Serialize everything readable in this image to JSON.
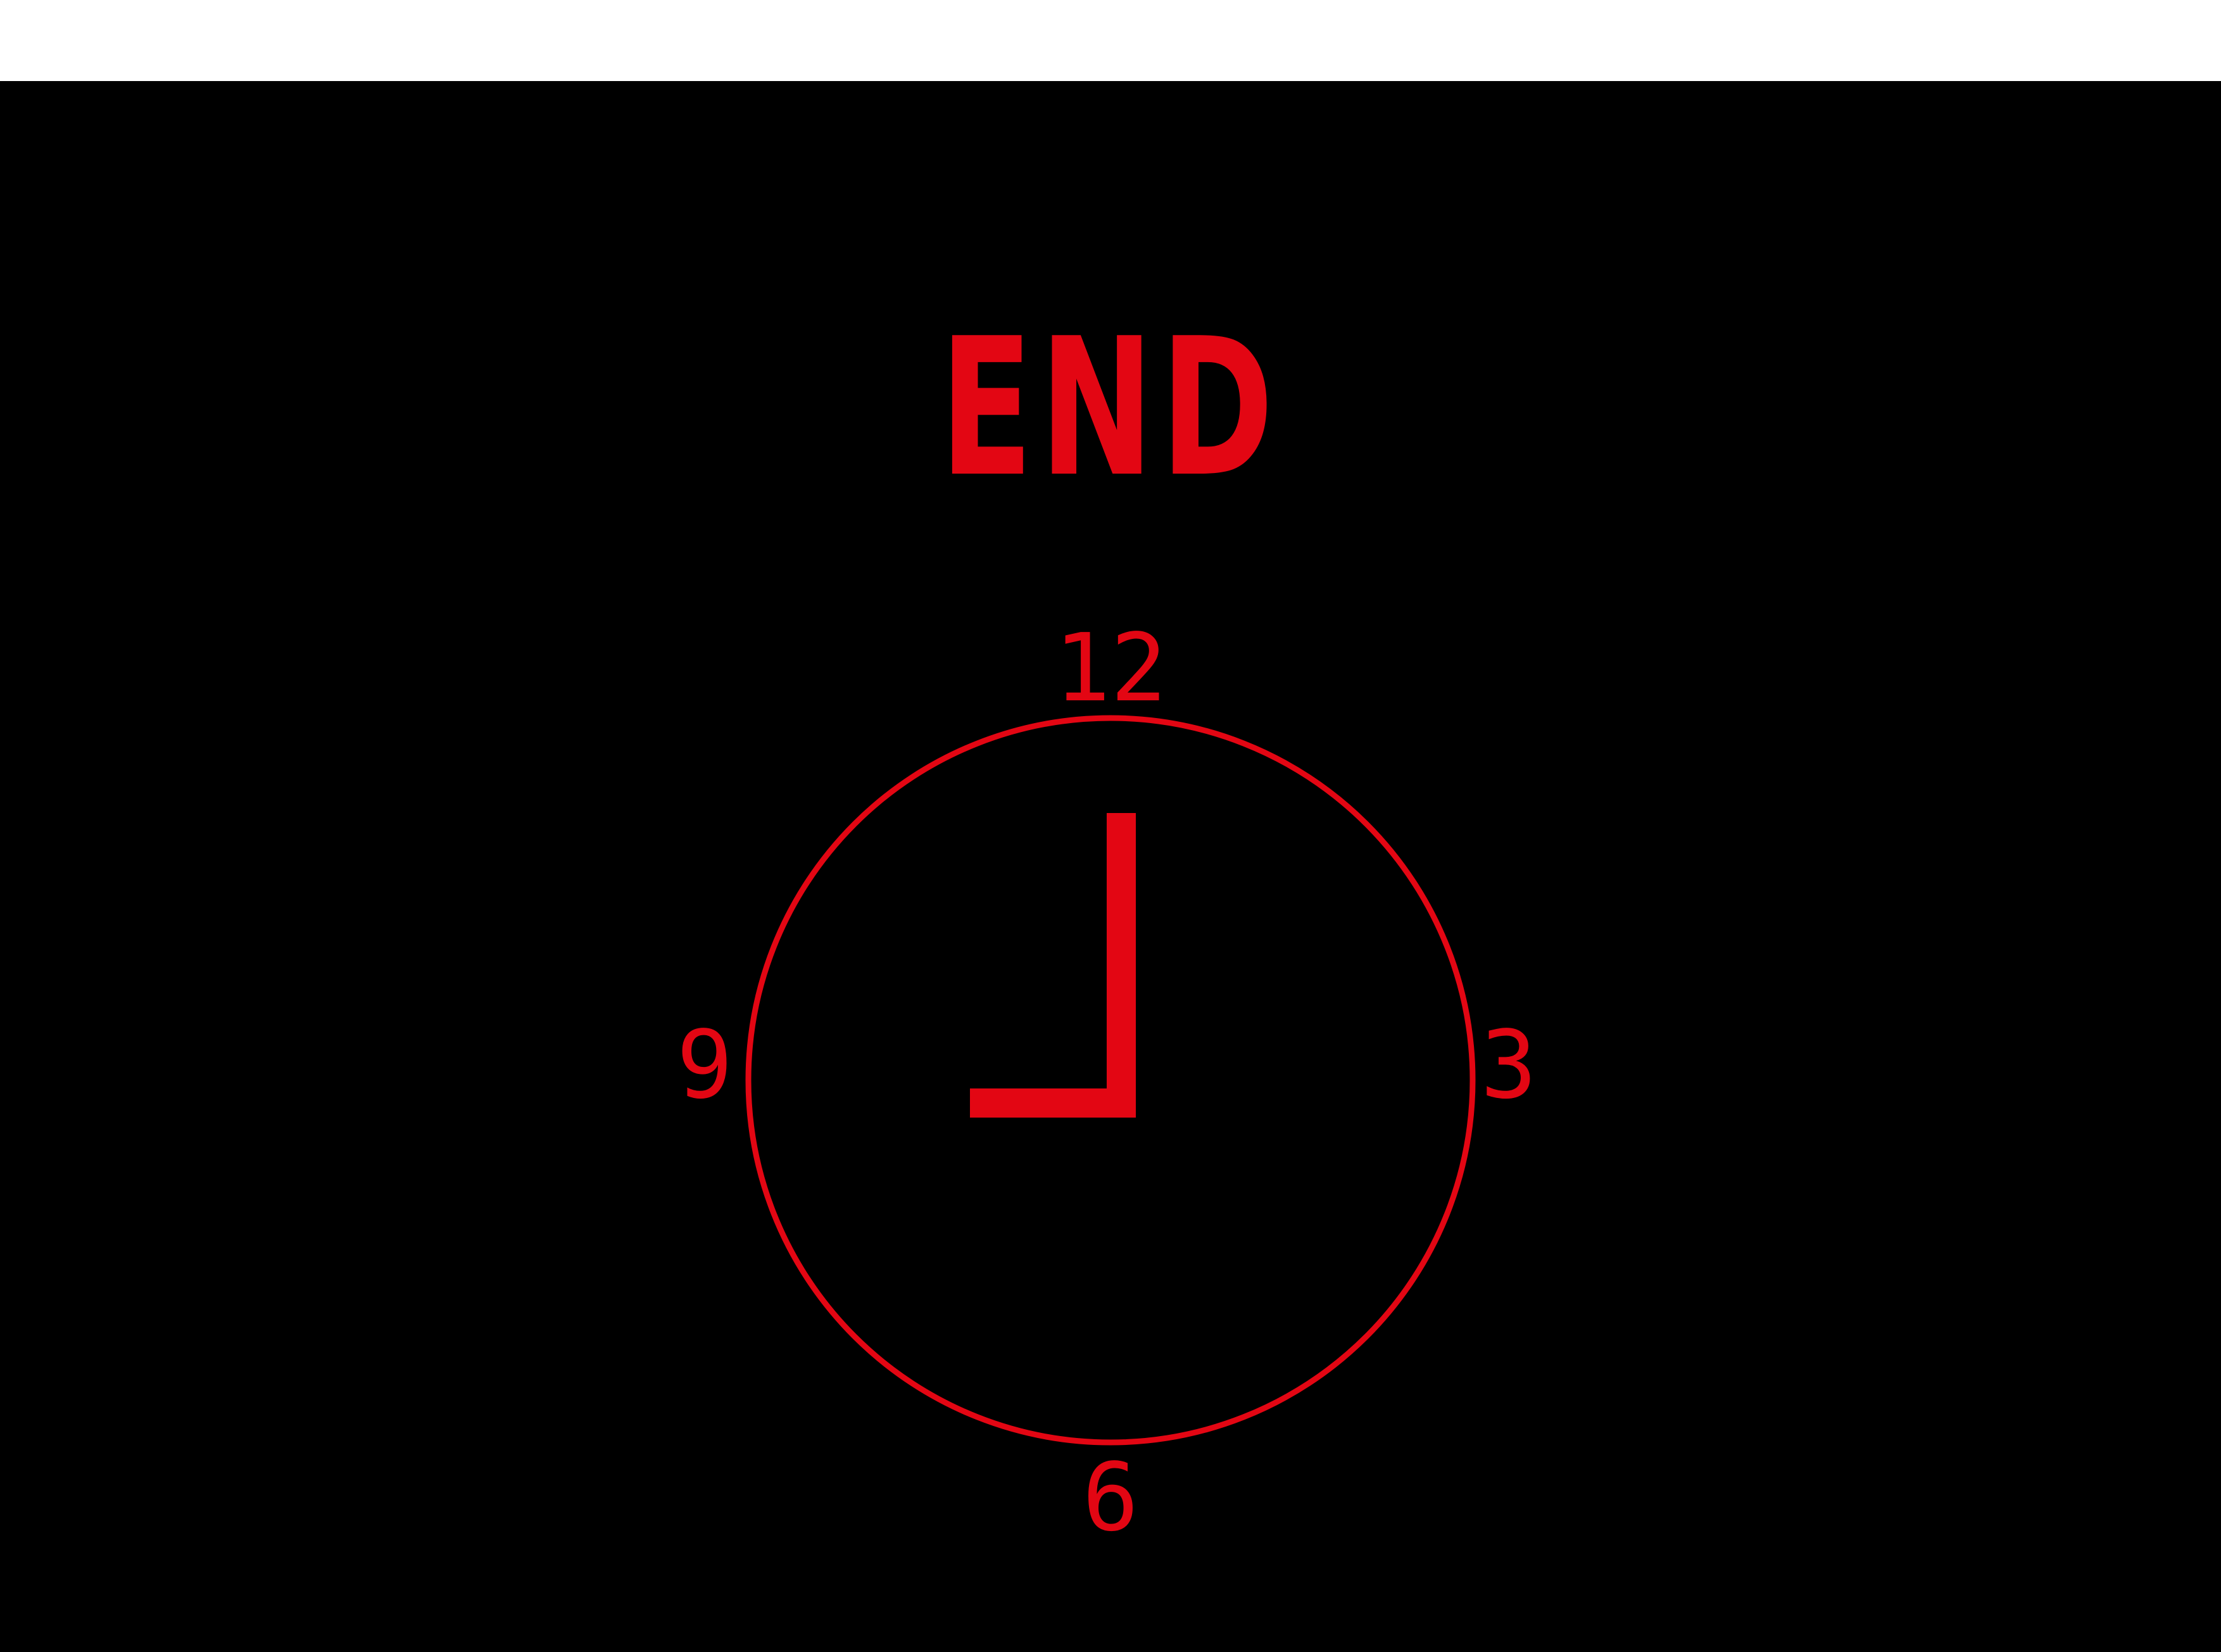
{
  "title": "END",
  "clock": {
    "numerals": {
      "top": "12",
      "right": "3",
      "bottom": "6",
      "left": "9"
    },
    "time": {
      "hour": 9,
      "minute": 0
    }
  },
  "colors": {
    "accent": "#e30613",
    "background": "#000000",
    "top_bar": "#ffffff"
  }
}
